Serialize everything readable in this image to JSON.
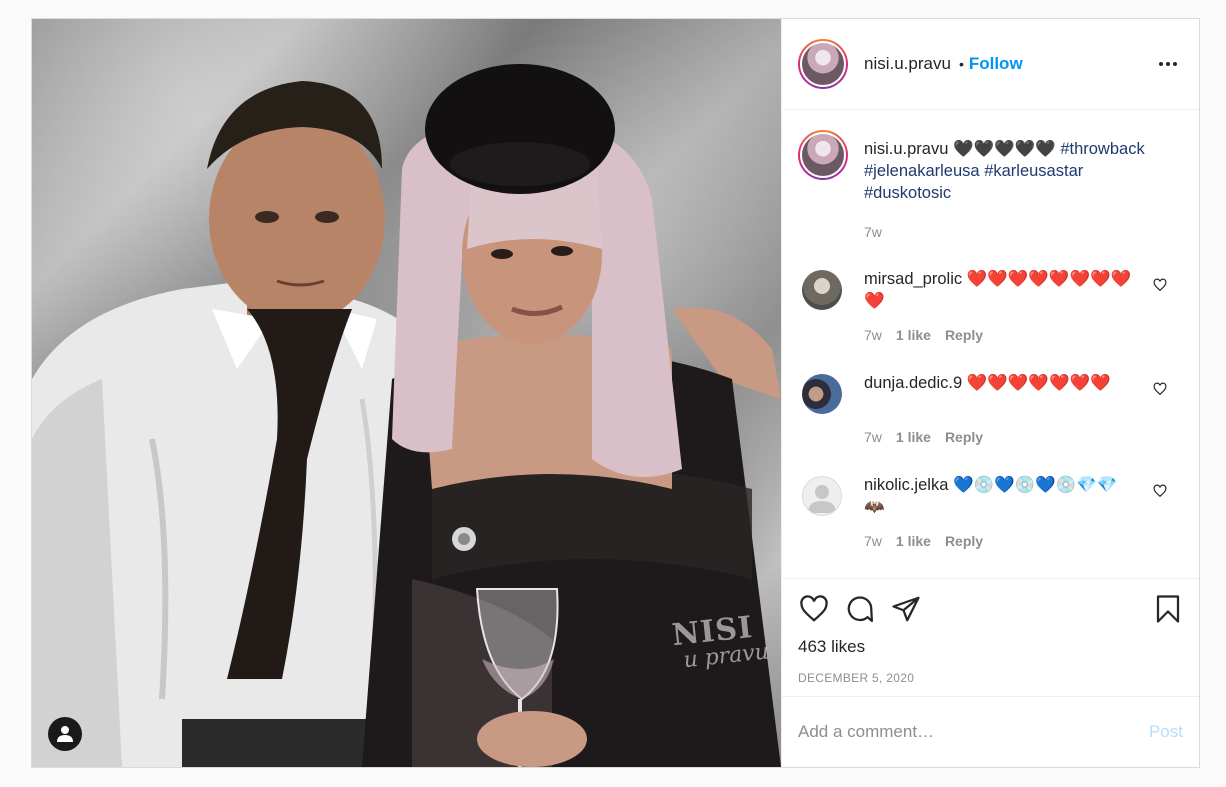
{
  "post": {
    "username": "nisi.u.pravu",
    "follow_label": "Follow",
    "header_dot": "•",
    "caption": {
      "username": "nisi.u.pravu",
      "hearts": "🖤🖤🖤🖤🖤",
      "tags": [
        "#throwback",
        "#jelenakarleusa",
        "#karleusastar",
        "#duskotosic"
      ],
      "time": "7w"
    },
    "comments": [
      {
        "username": "mirsad_prolic",
        "text": "❤️❤️❤️❤️❤️❤️❤️❤️❤️",
        "time": "7w",
        "likes": "1 like",
        "reply": "Reply"
      },
      {
        "username": "dunja.dedic.9",
        "text": "❤️❤️❤️❤️❤️❤️❤️",
        "time": "7w",
        "likes": "1 like",
        "reply": "Reply"
      },
      {
        "username": "nikolic.jelka",
        "text": "💙💿💙💿💙💿💎💎🦇",
        "time": "7w",
        "likes": "1 like",
        "reply": "Reply"
      }
    ],
    "likes_count": "463 likes",
    "date": "DECEMBER 5, 2020",
    "add_comment_placeholder": "Add a comment…",
    "post_button": "Post",
    "watermark": {
      "line1": "NISI",
      "line2": "u pravu"
    }
  },
  "colors": {
    "follow": "#0095f6",
    "hashtag": "#1e3a6e",
    "muted": "#8e8e8e",
    "post_disabled": "#b2dffc"
  },
  "icons": [
    "more-options-icon",
    "heart-icon",
    "comment-icon",
    "share-icon",
    "bookmark-icon",
    "user-tag-icon"
  ]
}
